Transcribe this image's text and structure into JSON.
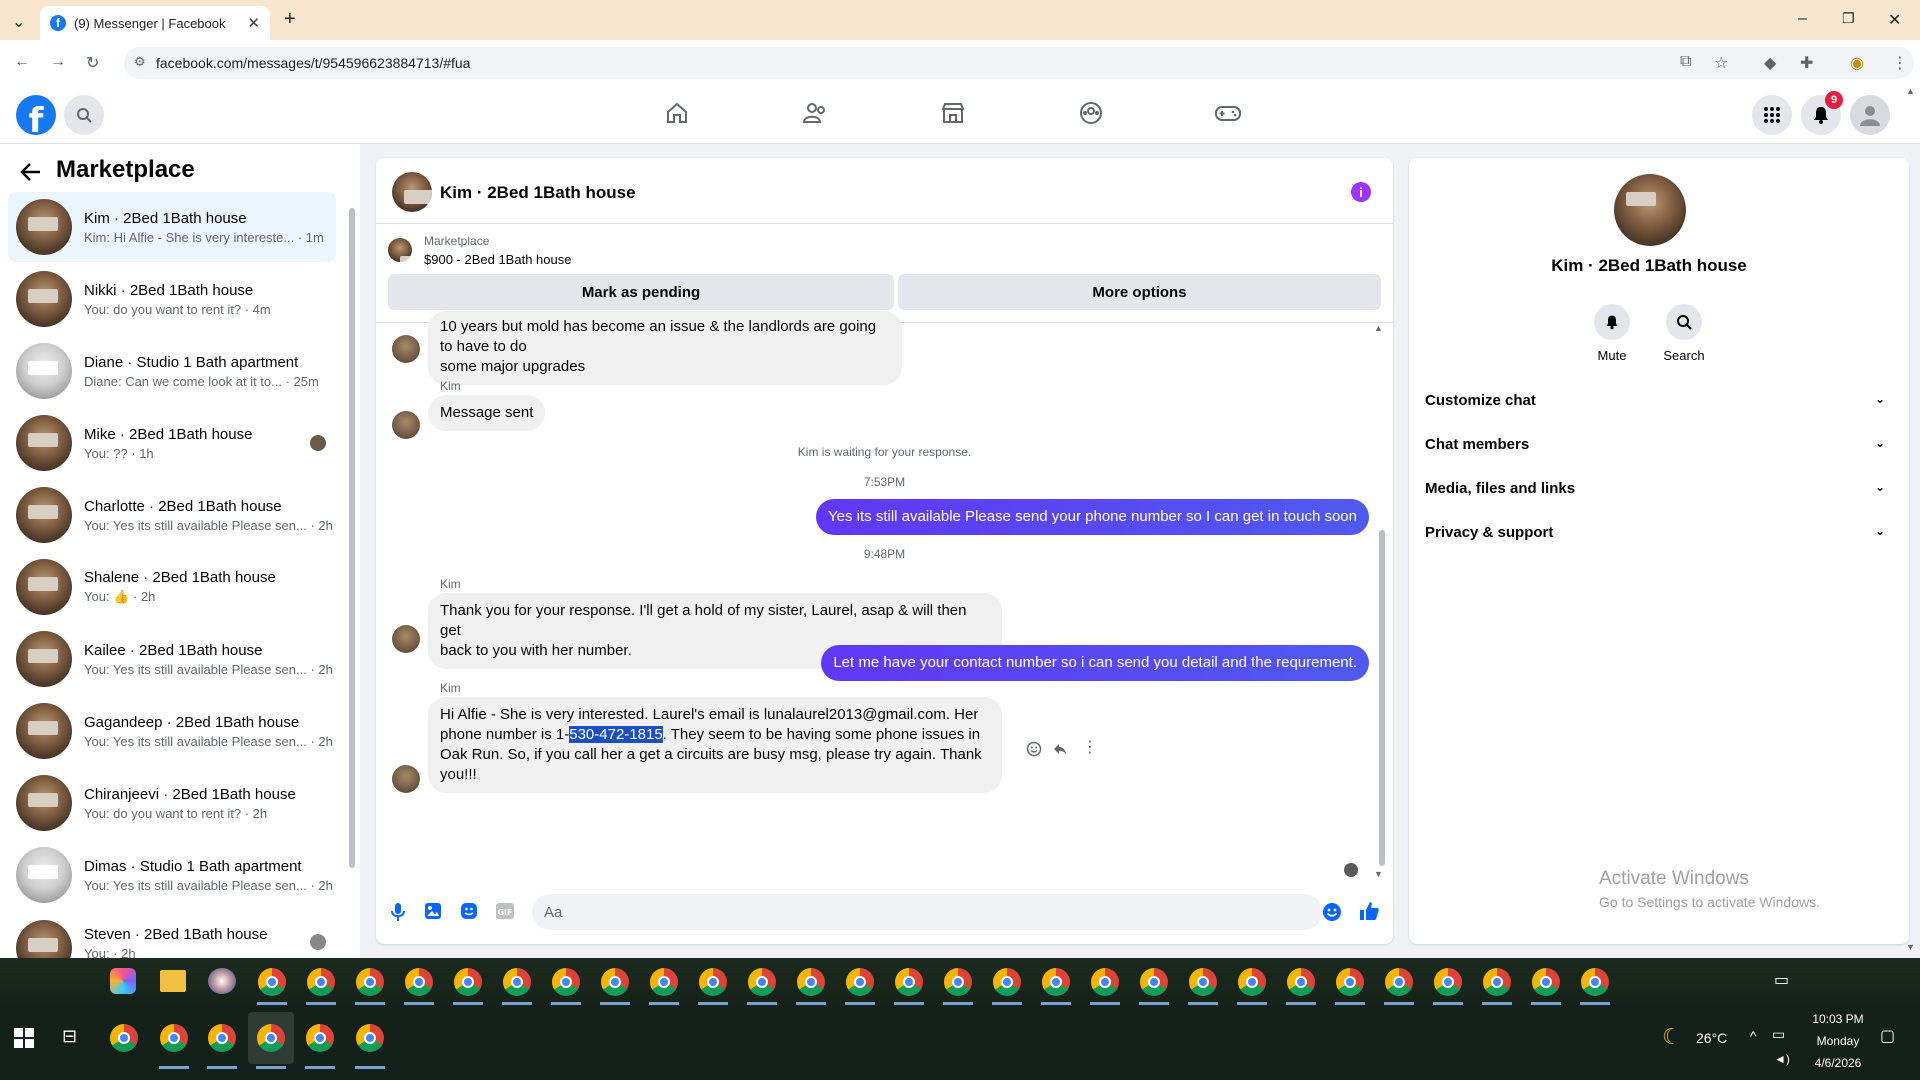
{
  "browser": {
    "tab_title": "(9) Messenger | Facebook",
    "url": "facebook.com/messages/t/954596623884713/#fua"
  },
  "fb": {
    "notifications_count": "9"
  },
  "sidebar": {
    "title": "Marketplace",
    "conversations": [
      {
        "name": "Kim · 2Bed 1Bath house",
        "preview": "Kim: Hi Alfie - She is very intereste...",
        "time": "1m"
      },
      {
        "name": "Nikki · 2Bed 1Bath house",
        "preview": "You: do you want to rent it?",
        "time": "4m"
      },
      {
        "name": "Diane · Studio 1 Bath apartment",
        "preview": "Diane: Can we come look at it to...",
        "time": "25m"
      },
      {
        "name": "Mike · 2Bed 1Bath house",
        "preview": "You: ??",
        "time": "1h"
      },
      {
        "name": "Charlotte · 2Bed 1Bath house",
        "preview": "You: Yes its still available Please sen...",
        "time": "2h"
      },
      {
        "name": "Shalene · 2Bed 1Bath house",
        "preview": "You:",
        "time": "2h"
      },
      {
        "name": "Kailee · 2Bed 1Bath house",
        "preview": "You: Yes its still available Please sen...",
        "time": "2h"
      },
      {
        "name": "Gagandeep · 2Bed 1Bath house",
        "preview": "You: Yes its still available Please sen...",
        "time": "2h"
      },
      {
        "name": "Chiranjeevi · 2Bed 1Bath house",
        "preview": "You: do you want to rent it?",
        "time": "2h"
      },
      {
        "name": "Dimas · Studio 1 Bath apartment",
        "preview": "You: Yes its still available Please sen...",
        "time": "2h"
      },
      {
        "name": "Steven · 2Bed 1Bath house",
        "preview": "You:",
        "time": "2h"
      }
    ]
  },
  "chat": {
    "title": "Kim · 2Bed 1Bath house",
    "marketplace_label": "Marketplace",
    "listing": "$900 - 2Bed 1Bath house",
    "mark_pending": "Mark as pending",
    "more_options": "More options",
    "msg1_line1": "10 years but mold has become an issue & the landlords are going to have to do",
    "msg1_line2": "some major upgrades",
    "sender": "Kim",
    "msg2": "Message sent",
    "waiting": "Kim is waiting for your response.",
    "time1": "7:53PM",
    "msg3": "Yes its still available Please send your phone number so I can get in touch soon",
    "time2": "9:48PM",
    "msg4_line1": "Thank you for your response.   I'll get a hold of my sister, Laurel, asap & will then get",
    "msg4_line2": "back to you with her number.",
    "msg5": "Let me have your contact number so i can send you detail and the requrement.",
    "msg6_line1": "Hi Alfie - She is very interested.    Laurel's email is lunalaurel2013@gmail.com.  Her",
    "msg6_line2_pre": "phone number is 1-",
    "msg6_phone": "530-472-1815",
    "msg6_line2_post": ".  They seem to be having some phone issues in",
    "msg6_line3": "Oak Run.   So, if you call her a get a circuits are busy msg, please try again.    Thank",
    "msg6_line4": "you!!!",
    "composer_placeholder": "Aa"
  },
  "rpanel": {
    "name": "Kim · 2Bed 1Bath house",
    "mute": "Mute",
    "search": "Search",
    "rows": [
      "Customize chat",
      "Chat members",
      "Media, files and links",
      "Privacy & support"
    ],
    "activate_title": "Activate Windows",
    "activate_sub": "Go to Settings to activate Windows."
  },
  "tray": {
    "temp": "26°C",
    "time": "10:03 PM",
    "day": "Monday",
    "date": "4/6/2026"
  },
  "colors": {
    "fb_blue": "#1877f2",
    "bubble_me": "#5b4cf7",
    "accent_purple": "#a033ff"
  }
}
